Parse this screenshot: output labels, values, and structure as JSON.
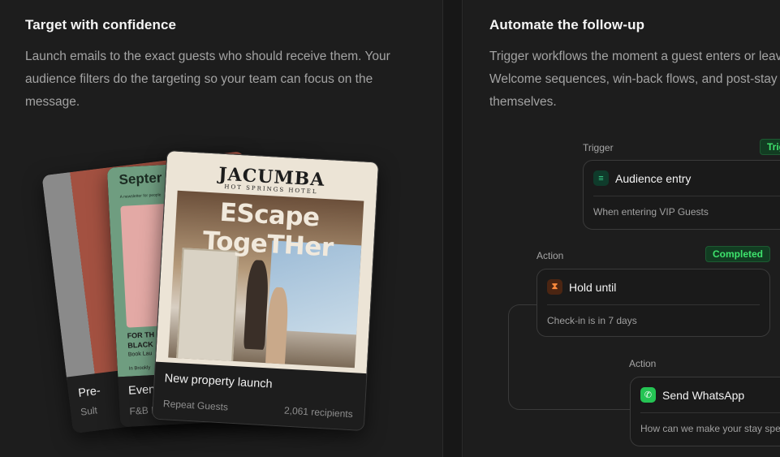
{
  "left": {
    "title": "Target with confidence",
    "description": "Launch emails to the exact guests who should receive them. Your audience filters do the targeting so your team can focus on the message."
  },
  "cards": {
    "back": {
      "title": "Pre-",
      "subtitle": "Sult"
    },
    "mid": {
      "title": "Even",
      "subtitle": "F&B L",
      "headline": "Septer",
      "tagline": "A newsletter for people",
      "body_line1": "FOR TH",
      "body_line2": "BLACK",
      "body_line3": "Book Lau",
      "body_line4": "In Brookly"
    },
    "front": {
      "brand": "JACUMBA",
      "brand_sub": "HOT SPRINGS HOTEL",
      "headline": "EScape TogeTHer",
      "title": "New property launch",
      "audience": "Repeat Guests",
      "recipients": "2,061 recipients"
    }
  },
  "right": {
    "title": "Automate the follow-up",
    "description": "Trigger workflows the moment a guest enters or leaves a segment. Welcome sequences, win-back flows, and post-stay campaigns run themselves."
  },
  "workflow": {
    "trigger": {
      "label": "Trigger",
      "badge": "Trig",
      "name": "Audience entry",
      "detail": "When entering VIP Guests",
      "icon": "audience-icon"
    },
    "hold": {
      "label": "Action",
      "badge": "Completed",
      "name": "Hold until",
      "detail": "Check-in is in 7 days",
      "icon": "hourglass-icon"
    },
    "whatsapp": {
      "label": "Action",
      "name": "Send WhatsApp",
      "detail": "How can we make your stay special?",
      "icon": "whatsapp-icon"
    }
  },
  "colors": {
    "background": "#1d1d1d",
    "badge_green": "#3ee46d",
    "accent_orange": "#ff8a3c",
    "whatsapp_green": "#25c454"
  }
}
